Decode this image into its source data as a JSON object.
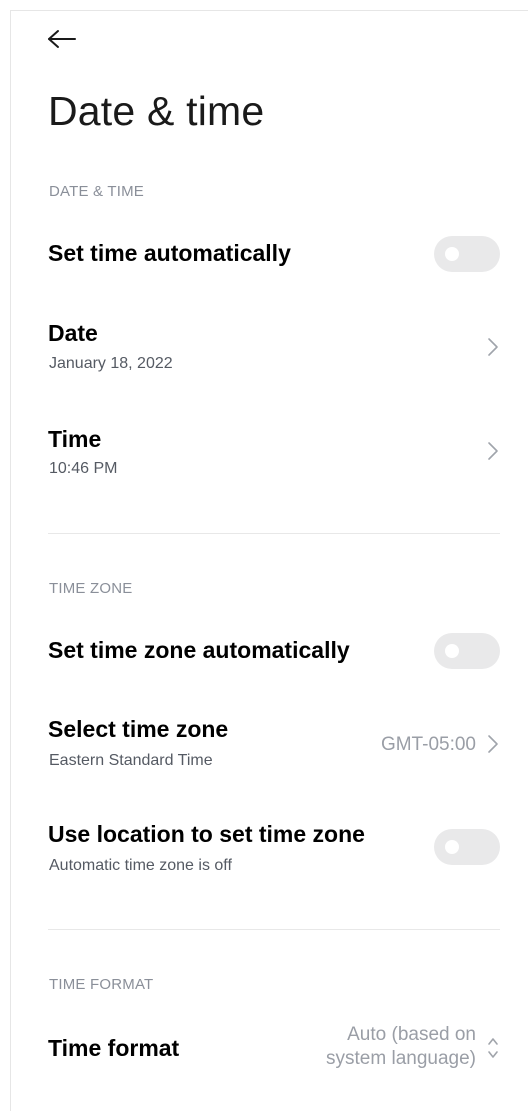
{
  "header": {
    "back_icon": "back-arrow-icon",
    "title": "Date & time"
  },
  "sections": {
    "date_time": {
      "header": "DATE & TIME",
      "set_time_auto": {
        "title": "Set time automatically",
        "enabled": false
      },
      "date": {
        "title": "Date",
        "subtitle": "January 18, 2022"
      },
      "time": {
        "title": "Time",
        "subtitle": "10:46 PM"
      }
    },
    "time_zone": {
      "header": "TIME ZONE",
      "set_zone_auto": {
        "title": "Set time zone automatically",
        "enabled": false
      },
      "select_zone": {
        "title": "Select time zone",
        "subtitle": "Eastern Standard Time",
        "value": "GMT-05:00"
      },
      "use_location": {
        "title": "Use location to set time zone",
        "subtitle": "Automatic time zone is off",
        "enabled": false
      }
    },
    "time_format": {
      "header": "TIME FORMAT",
      "format": {
        "title": "Time format",
        "value_line1": "Auto (based on",
        "value_line2": "system language)"
      }
    }
  },
  "colors": {
    "section_header": "#8a8f99",
    "toggle_off_track": "#e9e9ea",
    "secondary_text": "#555a63",
    "value_text": "#9a9ea6"
  }
}
